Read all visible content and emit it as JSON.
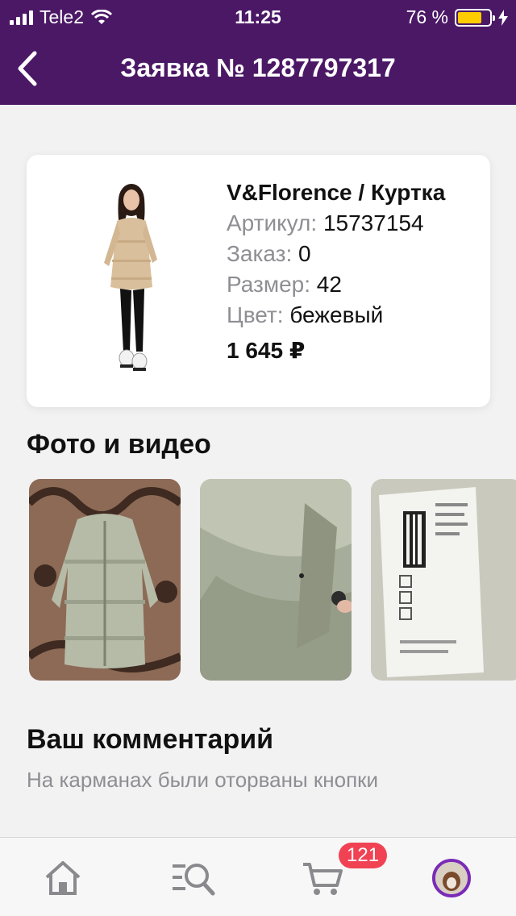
{
  "status_bar": {
    "carrier": "Tele2",
    "time": "11:25",
    "battery_percent": "76 %",
    "battery_level": 0.76,
    "battery_color": "#ffcc00"
  },
  "nav": {
    "title": "Заявка № 1287797317",
    "back_icon": "chevron-left-icon"
  },
  "product": {
    "name": "V&Florence / Куртка",
    "article_label": "Артикул:",
    "article_value": "15737154",
    "order_label": "Заказ:",
    "order_value": "0",
    "size_label": "Размер:",
    "size_value": "42",
    "color_label": "Цвет:",
    "color_value": "бежевый",
    "price": "1 645 ₽"
  },
  "media": {
    "title": "Фото и видео"
  },
  "comment": {
    "title": "Ваш комментарий",
    "text": "На карманах были оторваны кнопки"
  },
  "tabbar": {
    "items": [
      "home-icon",
      "catalog-search-icon",
      "cart-icon",
      "profile-avatar"
    ],
    "cart_badge": "121",
    "accent": "#7a2bb8",
    "badge_color": "#f14254"
  },
  "colors": {
    "header_bg": "#4b1866",
    "page_bg": "#f2f2f3"
  }
}
